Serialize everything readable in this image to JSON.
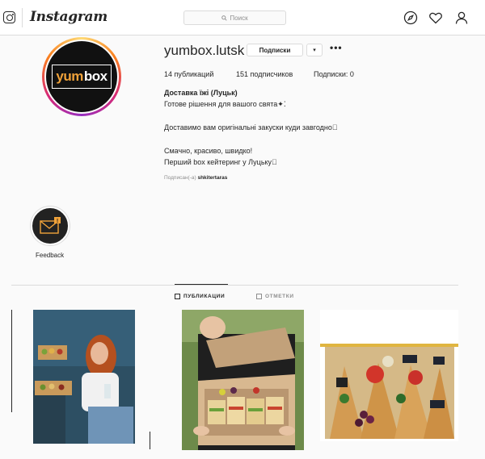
{
  "topbar": {
    "brand": "Instagram",
    "search_placeholder": "Поиск",
    "icons": [
      "instagram-glyph-icon",
      "explore-compass-icon",
      "heart-icon",
      "profile-icon"
    ]
  },
  "profile": {
    "username": "yumbox.lutsk",
    "logo_yum": "yum",
    "logo_box": "box",
    "follow_label": "Подписки",
    "dropdown_label": "▾",
    "more_label": "•••",
    "stats": {
      "posts": "14 публикаций",
      "followers": "151 подписчиков",
      "following": "Подписки: 0"
    },
    "bio_name": "Доставка їжі (Луцьк)",
    "bio_lines": [
      "Готове рішення для вашого свята✦⁚",
      "",
      "Доставимо вам оригінальні закуски куди завгодно⃞",
      "",
      "Смачно, красиво, швидко!",
      "Перший box кейтеринг у Луцьку⃞"
    ],
    "followed_prefix": "Подписан(-а)",
    "followed_user": "shkitertaras"
  },
  "highlights": [
    {
      "label": "Feedback",
      "icon": "envelope-icon",
      "badge": "!"
    }
  ],
  "tabs": {
    "posts": "ПУБЛИКАЦИИ",
    "tagged": "ОТМЕТКИ"
  },
  "colors": {
    "accent_orange": "#f0a23a",
    "border": "#dbdbdb",
    "text": "#262626",
    "muted": "#8e8e8e"
  }
}
